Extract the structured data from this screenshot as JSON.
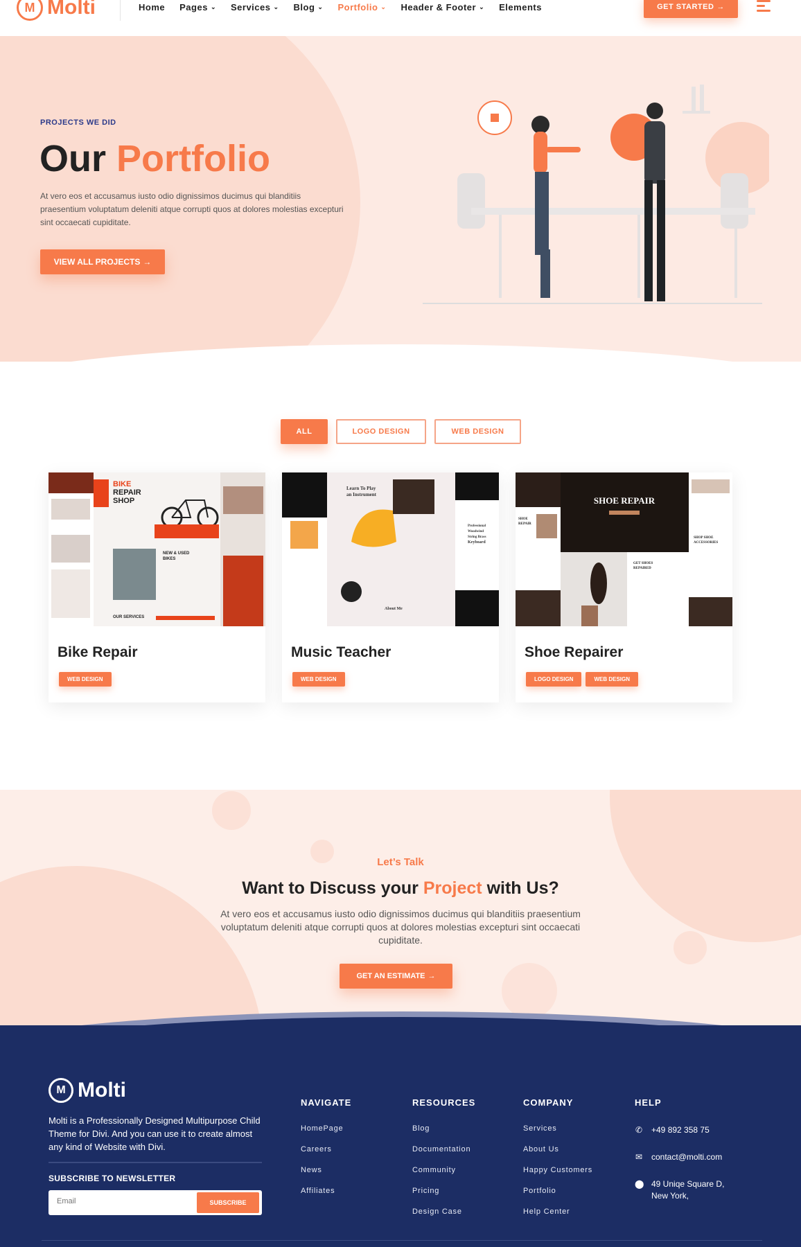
{
  "header": {
    "logo_mark": "M",
    "logo_text": "Molti",
    "nav": [
      {
        "label": "Home",
        "dropdown": false,
        "active": false
      },
      {
        "label": "Pages",
        "dropdown": true,
        "active": false
      },
      {
        "label": "Services",
        "dropdown": true,
        "active": false
      },
      {
        "label": "Blog",
        "dropdown": true,
        "active": false
      },
      {
        "label": "Portfolio",
        "dropdown": true,
        "active": true
      },
      {
        "label": "Header & Footer",
        "dropdown": true,
        "active": false
      },
      {
        "label": "Elements",
        "dropdown": false,
        "active": false
      }
    ],
    "cta_label": "GET STARTED",
    "cta_arrow": "→"
  },
  "hero": {
    "eyebrow": "PROJECTS WE DID",
    "title_dark": "Our",
    "title_accent": "Portfolio",
    "text": "At vero eos et accusamus iusto odio dignissimos ducimus qui blanditiis praesentium voluptatum deleniti atque corrupti quos at dolores molestias excepturi sint occaecati cupiditate.",
    "button_label": "VIEW ALL PROJECTS",
    "button_arrow": "→"
  },
  "filters": [
    {
      "label": "ALL",
      "active": true
    },
    {
      "label": "LOGO DESIGN",
      "active": false
    },
    {
      "label": "WEB DESIGN",
      "active": false
    }
  ],
  "projects": [
    {
      "title": "Bike Repair",
      "tags": [
        "WEB DESIGN"
      ],
      "thumb_text": [
        "BIKE",
        "REPAIR",
        "SHOP",
        "NEW & USED",
        "BIKES",
        "OUR SERVICES"
      ]
    },
    {
      "title": "Music Teacher",
      "tags": [
        "WEB DESIGN"
      ],
      "thumb_text": [
        "Learn To Play",
        "an Instrument",
        "Professional",
        "Woodwind",
        "String Brass",
        "Keyboard",
        "About Me"
      ]
    },
    {
      "title": "Shoe Repairer",
      "tags": [
        "LOGO DESIGN",
        "WEB DESIGN"
      ],
      "thumb_text": [
        "SHOE REPAIR",
        "SHOE",
        "REPAIR",
        "GET SHOES",
        "REPAIRED",
        "SHOP SHOE",
        "ACCESSORIES"
      ]
    }
  ],
  "cta": {
    "eyebrow": "Let’s Talk",
    "title_pre": "Want to Discuss your",
    "title_accent": "Project",
    "title_post": "with Us?",
    "text": "At vero eos et accusamus iusto odio dignissimos ducimus qui blanditiis praesentium voluptatum deleniti atque corrupti quos at dolores molestias excepturi sint occaecati cupiditate.",
    "button_label": "GET AN ESTIMATE",
    "button_arrow": "→"
  },
  "footer": {
    "logo_mark": "M",
    "logo_text": "Molti",
    "about": "Molti is a Professionally Designed  Multipurpose Child Theme for Divi. And you can use it to create almost any kind of Website with Divi.",
    "newsletter_title": "SUBSCRIBE TO NEWSLETTER",
    "email_placeholder": "Email",
    "subscribe_label": "SUBSCRIBE",
    "columns": [
      {
        "title": "NAVIGATE",
        "links": [
          "HomePage",
          "Careers",
          "News",
          "Affiliates"
        ]
      },
      {
        "title": "RESOURCES",
        "links": [
          "Blog",
          "Documentation",
          "Community",
          "Pricing",
          "Design Case"
        ]
      },
      {
        "title": "COMPANY",
        "links": [
          "Services",
          "About Us",
          "Happy Customers",
          "Portfolio",
          "Help Center"
        ]
      }
    ],
    "help": {
      "title": "HELP",
      "phone": "+49 892 358 75",
      "email": "contact@molti.com",
      "address": "49 Uniqe Square D, New York,"
    }
  },
  "colors": {
    "accent": "#f77a4a",
    "navy": "#1c2d64",
    "peach": "#fdeae3"
  }
}
